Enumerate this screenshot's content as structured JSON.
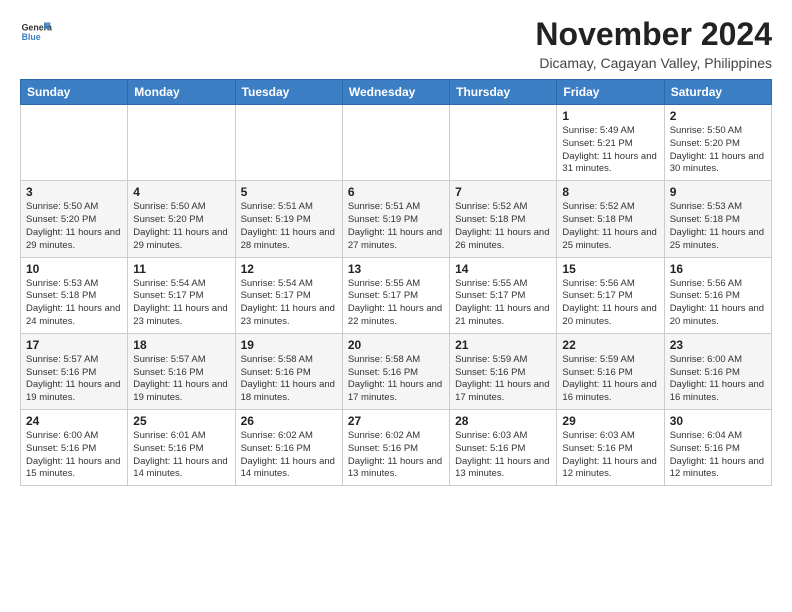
{
  "header": {
    "logo_line1": "General",
    "logo_line2": "Blue",
    "month_title": "November 2024",
    "location": "Dicamay, Cagayan Valley, Philippines"
  },
  "days_of_week": [
    "Sunday",
    "Monday",
    "Tuesday",
    "Wednesday",
    "Thursday",
    "Friday",
    "Saturday"
  ],
  "weeks": [
    [
      {
        "day": "",
        "info": ""
      },
      {
        "day": "",
        "info": ""
      },
      {
        "day": "",
        "info": ""
      },
      {
        "day": "",
        "info": ""
      },
      {
        "day": "",
        "info": ""
      },
      {
        "day": "1",
        "info": "Sunrise: 5:49 AM\nSunset: 5:21 PM\nDaylight: 11 hours and 31 minutes."
      },
      {
        "day": "2",
        "info": "Sunrise: 5:50 AM\nSunset: 5:20 PM\nDaylight: 11 hours and 30 minutes."
      }
    ],
    [
      {
        "day": "3",
        "info": "Sunrise: 5:50 AM\nSunset: 5:20 PM\nDaylight: 11 hours and 29 minutes."
      },
      {
        "day": "4",
        "info": "Sunrise: 5:50 AM\nSunset: 5:20 PM\nDaylight: 11 hours and 29 minutes."
      },
      {
        "day": "5",
        "info": "Sunrise: 5:51 AM\nSunset: 5:19 PM\nDaylight: 11 hours and 28 minutes."
      },
      {
        "day": "6",
        "info": "Sunrise: 5:51 AM\nSunset: 5:19 PM\nDaylight: 11 hours and 27 minutes."
      },
      {
        "day": "7",
        "info": "Sunrise: 5:52 AM\nSunset: 5:18 PM\nDaylight: 11 hours and 26 minutes."
      },
      {
        "day": "8",
        "info": "Sunrise: 5:52 AM\nSunset: 5:18 PM\nDaylight: 11 hours and 25 minutes."
      },
      {
        "day": "9",
        "info": "Sunrise: 5:53 AM\nSunset: 5:18 PM\nDaylight: 11 hours and 25 minutes."
      }
    ],
    [
      {
        "day": "10",
        "info": "Sunrise: 5:53 AM\nSunset: 5:18 PM\nDaylight: 11 hours and 24 minutes."
      },
      {
        "day": "11",
        "info": "Sunrise: 5:54 AM\nSunset: 5:17 PM\nDaylight: 11 hours and 23 minutes."
      },
      {
        "day": "12",
        "info": "Sunrise: 5:54 AM\nSunset: 5:17 PM\nDaylight: 11 hours and 23 minutes."
      },
      {
        "day": "13",
        "info": "Sunrise: 5:55 AM\nSunset: 5:17 PM\nDaylight: 11 hours and 22 minutes."
      },
      {
        "day": "14",
        "info": "Sunrise: 5:55 AM\nSunset: 5:17 PM\nDaylight: 11 hours and 21 minutes."
      },
      {
        "day": "15",
        "info": "Sunrise: 5:56 AM\nSunset: 5:17 PM\nDaylight: 11 hours and 20 minutes."
      },
      {
        "day": "16",
        "info": "Sunrise: 5:56 AM\nSunset: 5:16 PM\nDaylight: 11 hours and 20 minutes."
      }
    ],
    [
      {
        "day": "17",
        "info": "Sunrise: 5:57 AM\nSunset: 5:16 PM\nDaylight: 11 hours and 19 minutes."
      },
      {
        "day": "18",
        "info": "Sunrise: 5:57 AM\nSunset: 5:16 PM\nDaylight: 11 hours and 19 minutes."
      },
      {
        "day": "19",
        "info": "Sunrise: 5:58 AM\nSunset: 5:16 PM\nDaylight: 11 hours and 18 minutes."
      },
      {
        "day": "20",
        "info": "Sunrise: 5:58 AM\nSunset: 5:16 PM\nDaylight: 11 hours and 17 minutes."
      },
      {
        "day": "21",
        "info": "Sunrise: 5:59 AM\nSunset: 5:16 PM\nDaylight: 11 hours and 17 minutes."
      },
      {
        "day": "22",
        "info": "Sunrise: 5:59 AM\nSunset: 5:16 PM\nDaylight: 11 hours and 16 minutes."
      },
      {
        "day": "23",
        "info": "Sunrise: 6:00 AM\nSunset: 5:16 PM\nDaylight: 11 hours and 16 minutes."
      }
    ],
    [
      {
        "day": "24",
        "info": "Sunrise: 6:00 AM\nSunset: 5:16 PM\nDaylight: 11 hours and 15 minutes."
      },
      {
        "day": "25",
        "info": "Sunrise: 6:01 AM\nSunset: 5:16 PM\nDaylight: 11 hours and 14 minutes."
      },
      {
        "day": "26",
        "info": "Sunrise: 6:02 AM\nSunset: 5:16 PM\nDaylight: 11 hours and 14 minutes."
      },
      {
        "day": "27",
        "info": "Sunrise: 6:02 AM\nSunset: 5:16 PM\nDaylight: 11 hours and 13 minutes."
      },
      {
        "day": "28",
        "info": "Sunrise: 6:03 AM\nSunset: 5:16 PM\nDaylight: 11 hours and 13 minutes."
      },
      {
        "day": "29",
        "info": "Sunrise: 6:03 AM\nSunset: 5:16 PM\nDaylight: 11 hours and 12 minutes."
      },
      {
        "day": "30",
        "info": "Sunrise: 6:04 AM\nSunset: 5:16 PM\nDaylight: 11 hours and 12 minutes."
      }
    ]
  ]
}
